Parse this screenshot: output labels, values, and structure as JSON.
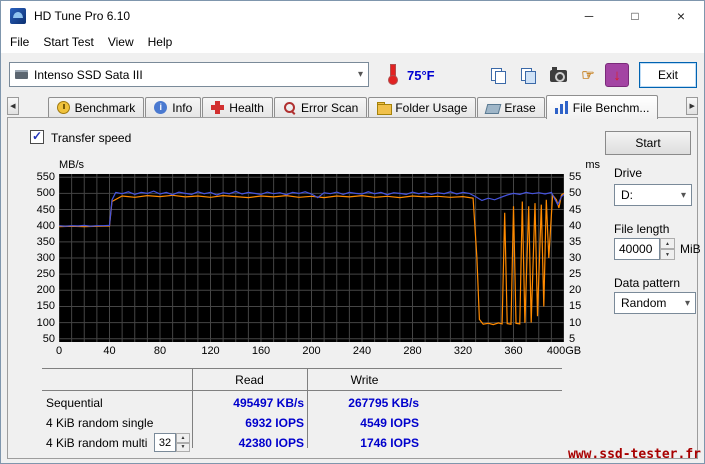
{
  "window": {
    "title": "HD Tune Pro 6.10"
  },
  "menu": {
    "items": [
      "File",
      "Start Test",
      "View",
      "Help"
    ]
  },
  "toolbar": {
    "drive_select": "Intenso SSD Sata III",
    "temperature": "75°F",
    "exit_label": "Exit"
  },
  "tabs": {
    "items": [
      {
        "label": "Benchmark"
      },
      {
        "label": "Info"
      },
      {
        "label": "Health"
      },
      {
        "label": "Error Scan"
      },
      {
        "label": "Folder Usage"
      },
      {
        "label": "Erase"
      },
      {
        "label": "File Benchm..."
      }
    ],
    "active_index": 6
  },
  "controls": {
    "transfer_speed_label": "Transfer speed",
    "start_label": "Start",
    "drive_label": "Drive",
    "drive_value": "D:",
    "file_length_label": "File length",
    "file_length_value": "40000",
    "file_length_unit": "MiB",
    "data_pattern_label": "Data pattern",
    "data_pattern_value": "Random"
  },
  "results": {
    "columns": [
      "Read",
      "Write"
    ],
    "rows": [
      {
        "label": "Sequential",
        "read": "495497 KB/s",
        "write": "267795 KB/s"
      },
      {
        "label": "4 KiB random single",
        "read": "6932 IOPS",
        "write": "4549 IOPS"
      },
      {
        "label": "4 KiB random multi",
        "queue_depth": "32",
        "read": "42380 IOPS",
        "write": "1746 IOPS"
      }
    ]
  },
  "watermark": "www.ssd-tester.fr",
  "icons": {
    "minimize": "─",
    "maximize": "□",
    "close": "×",
    "chevron_down": "▾",
    "scroll_left": "◀",
    "scroll_right": "▶",
    "hand": "☞",
    "download_arrow": "↓",
    "check": "✓",
    "spin_up": "▲",
    "spin_down": "▼"
  },
  "chart_data": {
    "type": "line",
    "ylabel_left": "MB/s",
    "ylabel_right": "ms",
    "xlim": [
      0,
      400
    ],
    "ylim": [
      40,
      560
    ],
    "x_grid_step": 10,
    "grid_color": "#454545",
    "plot_bg": "#000000",
    "x_tick_values": [
      0,
      40,
      80,
      120,
      160,
      200,
      240,
      280,
      320,
      360,
      400
    ],
    "x_tick_labels": [
      "0",
      "40",
      "80",
      "120",
      "160",
      "200",
      "240",
      "280",
      "320",
      "360",
      "400GB"
    ],
    "y_ticks_left": [
      550,
      500,
      450,
      400,
      350,
      300,
      250,
      200,
      150,
      100,
      50
    ],
    "y_ticks_right": [
      55,
      50,
      45,
      40,
      35,
      30,
      25,
      20,
      15,
      10,
      5
    ],
    "series": [
      {
        "name": "write_speed",
        "color": "#ff8a00",
        "x": [
          0,
          10,
          20,
          30,
          40,
          42,
          50,
          60,
          70,
          80,
          90,
          100,
          110,
          120,
          130,
          140,
          150,
          160,
          170,
          180,
          190,
          200,
          210,
          220,
          230,
          240,
          250,
          260,
          270,
          280,
          290,
          300,
          310,
          320,
          328,
          331,
          333,
          336,
          340,
          344,
          348,
          351,
          353,
          355,
          358,
          360,
          362,
          365,
          367,
          369,
          372,
          374,
          377,
          379,
          382,
          384,
          386,
          388,
          391,
          394,
          396,
          398,
          400
        ],
        "y": [
          397,
          398,
          397,
          398,
          399,
          475,
          492,
          488,
          493,
          490,
          494,
          489,
          492,
          488,
          493,
          490,
          487,
          492,
          489,
          493,
          488,
          491,
          487,
          492,
          489,
          493,
          488,
          491,
          487,
          492,
          489,
          491,
          488,
          490,
          485,
          300,
          110,
          95,
          98,
          94,
          99,
          96,
          440,
          97,
          95,
          460,
          98,
          96,
          475,
          99,
          460,
          100,
          470,
          120,
          465,
          150,
          480,
          300,
          495,
          480,
          455,
          495,
          500
        ]
      },
      {
        "name": "read_speed",
        "color": "#4553dd",
        "x": [
          0,
          5,
          10,
          15,
          20,
          25,
          30,
          35,
          40,
          42,
          45,
          50,
          55,
          60,
          65,
          70,
          75,
          80,
          85,
          90,
          95,
          100,
          105,
          110,
          115,
          120,
          125,
          130,
          135,
          140,
          145,
          150,
          155,
          160,
          165,
          170,
          175,
          180,
          185,
          190,
          195,
          200,
          205,
          210,
          215,
          220,
          225,
          230,
          235,
          240,
          245,
          250,
          255,
          260,
          265,
          270,
          275,
          280,
          285,
          290,
          295,
          300,
          305,
          310,
          315,
          320,
          325,
          330,
          335,
          340,
          345,
          350,
          355,
          360,
          365,
          370,
          375,
          380,
          385,
          390,
          395,
          398,
          400
        ],
        "y": [
          400,
          398,
          400,
          399,
          401,
          398,
          400,
          400,
          401,
          480,
          503,
          499,
          505,
          497,
          503,
          500,
          507,
          498,
          503,
          496,
          504,
          500,
          497,
          505,
          499,
          503,
          495,
          502,
          499,
          506,
          498,
          503,
          500,
          497,
          504,
          499,
          502,
          496,
          503,
          500,
          505,
          498,
          487,
          502,
          499,
          504,
          497,
          503,
          500,
          498,
          505,
          499,
          503,
          496,
          502,
          500,
          497,
          504,
          499,
          503,
          497,
          502,
          499,
          505,
          498,
          503,
          500,
          490,
          478,
          485,
          480,
          488,
          495,
          500,
          497,
          503,
          499,
          502,
          498,
          503,
          465,
          490,
          497
        ]
      }
    ]
  }
}
